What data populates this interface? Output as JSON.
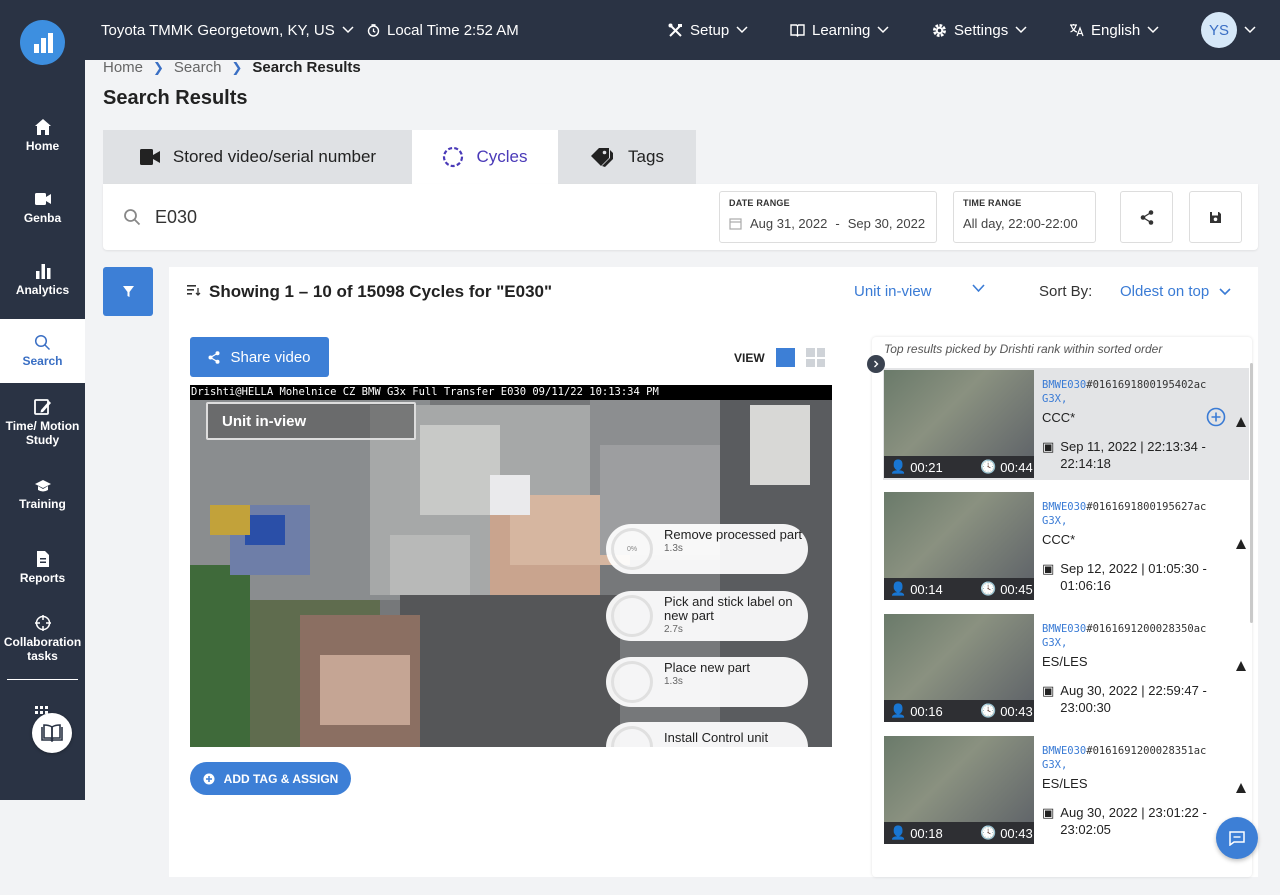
{
  "topbar": {
    "location": "Toyota TMMK Georgetown, KY, US",
    "local_time": "Local Time 2:52 AM",
    "setup": "Setup",
    "learning": "Learning",
    "settings": "Settings",
    "language": "English",
    "user_initials": "YS"
  },
  "sidebar": {
    "items": [
      {
        "label": "Home",
        "icon": "home-icon"
      },
      {
        "label": "Genba",
        "icon": "video-camera-icon"
      },
      {
        "label": "Analytics",
        "icon": "bar-chart-icon"
      },
      {
        "label": "Search",
        "icon": "search-icon"
      },
      {
        "label": "Time/ Motion Study",
        "icon": "edit-icon"
      },
      {
        "label": "Training",
        "icon": "graduation-cap-icon"
      },
      {
        "label": "Reports",
        "icon": "document-icon"
      },
      {
        "label": "Collaboration tasks",
        "icon": "crosshair-icon"
      }
    ]
  },
  "breadcrumb": {
    "home": "Home",
    "search": "Search",
    "current": "Search Results"
  },
  "page_title": "Search Results",
  "tabs": [
    {
      "label": "Stored video/serial number",
      "icon": "video-camera-icon"
    },
    {
      "label": "Cycles",
      "icon": "cycle-icon"
    },
    {
      "label": "Tags",
      "icon": "tag-icon"
    }
  ],
  "search": {
    "query": "E030",
    "date_range_label": "DATE RANGE",
    "date_from": "Aug 31, 2022",
    "date_sep": "-",
    "date_to": "Sep 30, 2022",
    "time_range_label": "TIME RANGE",
    "time_range": "All day, 22:00-22:00"
  },
  "results": {
    "showing": "Showing 1 – 10 of 15098 Cycles for \"E030\"",
    "unit_view": "Unit in-view",
    "sort_label": "Sort By:",
    "sort_value": "Oldest on top",
    "share_video": "Share video",
    "view_label": "VIEW",
    "add_tag": "ADD TAG & ASSIGN"
  },
  "video": {
    "header": "Drishti@HELLA Mohelnice CZ BMW G3x Full Transfer E030 09/11/22 10:13:34 PM",
    "overlay": "Unit in-view",
    "steps": [
      {
        "name": "Remove processed part",
        "time": "1.3s",
        "progress": "0%"
      },
      {
        "name": "Pick and stick label on new part",
        "time": "2.7s",
        "progress": ""
      },
      {
        "name": "Place new part",
        "time": "1.3s",
        "progress": ""
      },
      {
        "name": "Install Control unit",
        "time": "",
        "progress": ""
      }
    ]
  },
  "right_panel": {
    "caption": "Top results picked by Drishti rank within sorted order",
    "cards": [
      {
        "id_prefix": "BMWE030",
        "id_rest": "#0161691800195402ac",
        "id_line2": "G3X,",
        "status": "CCC*",
        "date1": "Sep 11, 2022 | 22:13:34 -",
        "date2": "22:14:18",
        "t1": "00:21",
        "t2": "00:44"
      },
      {
        "id_prefix": "BMWE030",
        "id_rest": "#0161691800195627ac",
        "id_line2": "G3X,",
        "status": "CCC*",
        "date1": "Sep 12, 2022 | 01:05:30 -",
        "date2": "01:06:16",
        "t1": "00:14",
        "t2": "00:45"
      },
      {
        "id_prefix": "BMWE030",
        "id_rest": "#0161691200028350ac",
        "id_line2": "G3X,",
        "status": "ES/LES",
        "date1": "Aug 30, 2022 | 22:59:47 -",
        "date2": "23:00:30",
        "t1": "00:16",
        "t2": "00:43"
      },
      {
        "id_prefix": "BMWE030",
        "id_rest": "#0161691200028351ac",
        "id_line2": "G3X,",
        "status": "ES/LES",
        "date1": "Aug 30, 2022 | 23:01:22 -",
        "date2": "23:02:05",
        "t1": "00:18",
        "t2": "00:43"
      }
    ]
  },
  "colors": {
    "accent": "#3d7fd6",
    "sidebar": "#2a3344",
    "tab_active": "#4a3ab8"
  }
}
